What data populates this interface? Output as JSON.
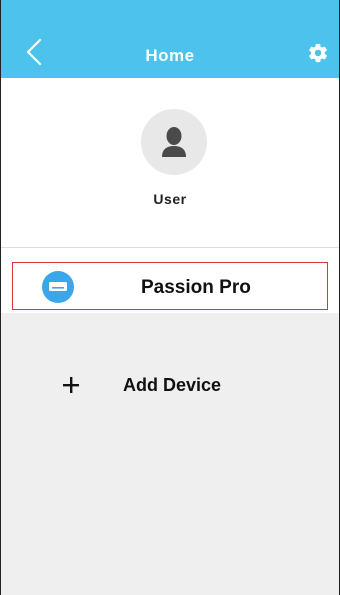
{
  "header": {
    "title": "Home",
    "back_icon": "chevron-left-icon",
    "settings_icon": "gear-icon",
    "color": "#4cc2ec"
  },
  "profile": {
    "avatar_icon": "user-icon",
    "name": "User"
  },
  "devices": [
    {
      "name": "Passion Pro",
      "icon": "air-conditioner-icon",
      "icon_color": "#3aa7ea",
      "selected": true
    }
  ],
  "actions": {
    "add_icon": "plus-icon",
    "add_label": "Add Device"
  },
  "colors": {
    "selection_border": "#d9363e",
    "lower_background": "#efefef"
  }
}
